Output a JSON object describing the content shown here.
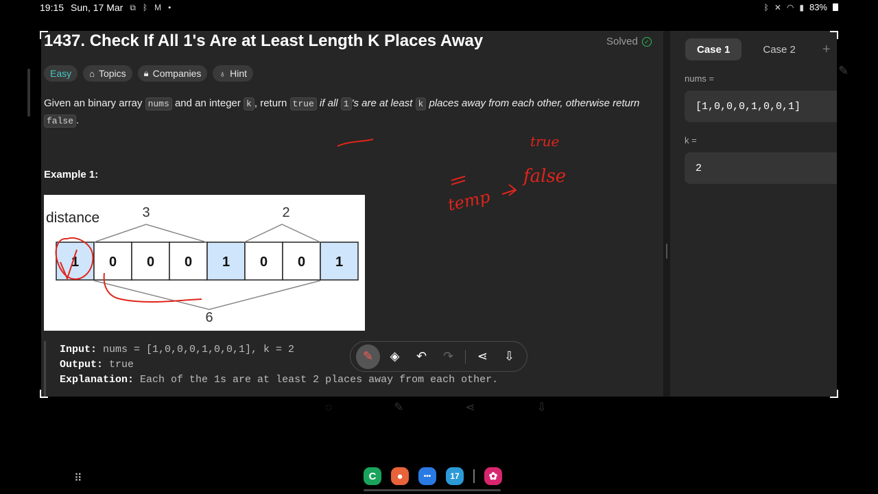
{
  "status_bar": {
    "time": "19:15",
    "date": "Sun, 17 Mar",
    "battery": "83%",
    "icons_left": [
      "screenshot-icon",
      "bluetooth-icon",
      "gmail-icon",
      "dot-icon"
    ],
    "icons_right": [
      "bluetooth-icon",
      "mute-icon",
      "wifi-icon",
      "signal-icon",
      "battery-icon"
    ]
  },
  "problem": {
    "title": "1437. Check If All 1's Are at Least Length K Places Away",
    "status": "Solved",
    "tags": [
      {
        "label": "Easy",
        "icon": ""
      },
      {
        "label": "Topics",
        "icon": "tag-icon"
      },
      {
        "label": "Companies",
        "icon": "lock-icon"
      },
      {
        "label": "Hint",
        "icon": "lightbulb-icon"
      }
    ],
    "desc": {
      "p1": "Given an binary array ",
      "c1": "nums",
      "p2": " and an integer ",
      "c2": "k",
      "p3": ", return ",
      "c3": "true",
      "i1": " if all ",
      "c4": "1",
      "i2": "'s are at least ",
      "c5": "k",
      "i3": " places away from each other, otherwise return",
      "c6": "false",
      "p4": "."
    },
    "example_title": "Example 1:",
    "example": {
      "input_key": "Input:",
      "input_val": " nums = [1,0,0,0,1,0,0,1], k = 2",
      "output_key": "Output:",
      "output_val": " true",
      "explain_key": "Explanation:",
      "explain_val": " Each of the 1s are at least 2 places away from each other."
    },
    "figure": {
      "label": "distance",
      "cells": [
        "1",
        "0",
        "0",
        "0",
        "1",
        "0",
        "0",
        "1"
      ],
      "highlight_color": "#cfe5fb",
      "dist_a": "3",
      "dist_b": "2",
      "dist_total": "6"
    }
  },
  "handwriting": {
    "word_top": "true",
    "word_mid": "false",
    "word_left": "temp"
  },
  "toolbar": {
    "buttons": [
      "pen-icon",
      "eraser-icon",
      "undo-icon",
      "redo-icon",
      "share-icon",
      "download-icon"
    ]
  },
  "testcases": {
    "tabs": [
      "Case 1",
      "Case 2"
    ],
    "add": "+",
    "nums_label": "nums =",
    "nums_value": "[1,0,0,0,1,0,0,1]",
    "k_label": "k =",
    "k_value": "2"
  },
  "colors": {
    "easy": "#46c6c2",
    "solved_check": "#2cbb5d",
    "annotation": "#e0241b"
  },
  "dock": {
    "apps": [
      {
        "name": "phone-app-icon",
        "glyph": "C",
        "color": "#1aa35c"
      },
      {
        "name": "contacts-app-icon",
        "glyph": "●",
        "color": "#e8623a"
      },
      {
        "name": "messages-app-icon",
        "glyph": "•••",
        "color": "#2a7ae4"
      },
      {
        "name": "calendar-app-icon",
        "glyph": "17",
        "color": "#2d9ad8"
      },
      {
        "name": "gallery-app-icon",
        "glyph": "✿",
        "color": "#d8266e"
      }
    ]
  }
}
